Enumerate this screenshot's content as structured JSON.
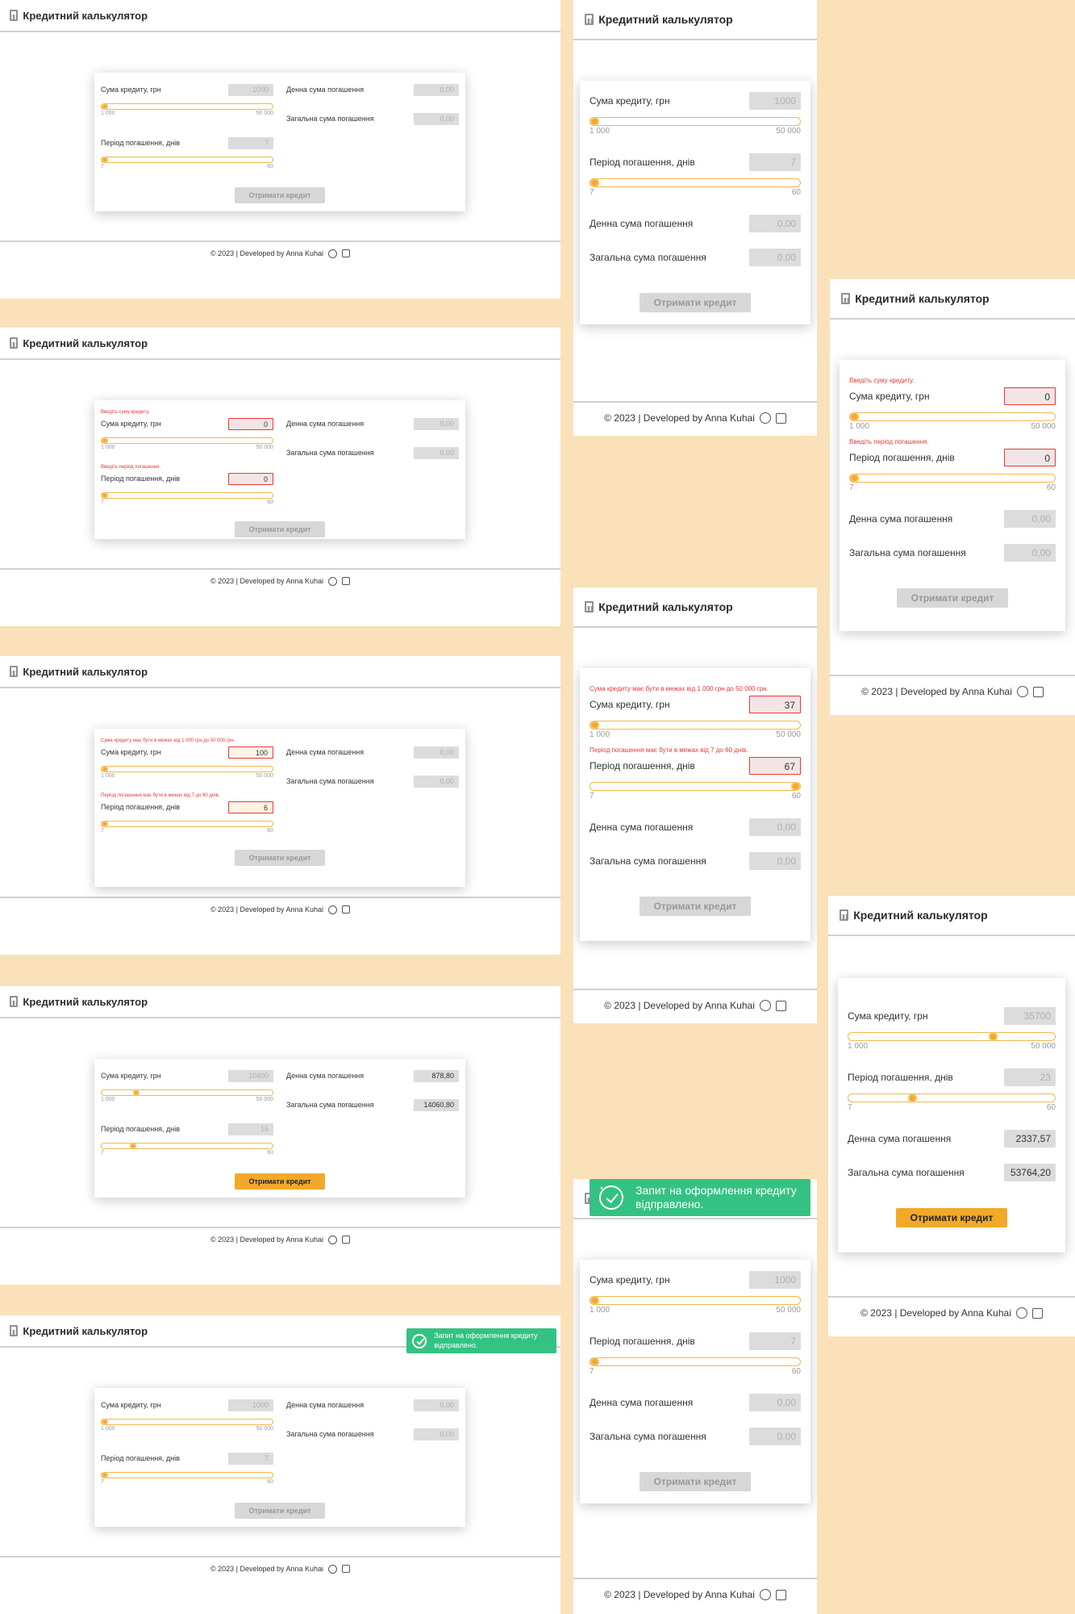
{
  "app": {
    "title": "Кредитний калькулятор",
    "footer": "© 2023 | Developed by Anna Kuhai",
    "amount_label": "Сума кредиту, грн",
    "period_label": "Період погашення, днів",
    "daily_label": "Денна сума погашення",
    "total_label": "Загальна сума погашення",
    "amount_min_tick": "1 000",
    "amount_max_tick": "50 000",
    "period_min_tick": "7",
    "period_max_tick": "60",
    "submit_label": "Отримати кредит",
    "err_amount_empty": "Введіть суму кредиту.",
    "err_period_empty": "Введіть період погашення.",
    "err_amount_range": "Сума кредиту має бути в межах від 1 000 грн до 50 000 грн.",
    "err_period_range": "Період погашення має бути в межах від 7 до 60 днів.",
    "toast_text": "Запит на оформлення кредиту відправлено."
  },
  "states": {
    "initial": {
      "amount": "1000",
      "period": "7",
      "daily": "0,00",
      "total": "0,00",
      "amount_pos": 0,
      "period_pos": 0
    },
    "empty": {
      "amount": "0",
      "period": "0",
      "daily": "0,00",
      "total": "0,00",
      "amount_pos": 0,
      "period_pos": 0
    },
    "out_of_range": {
      "amount": "100",
      "period": "6",
      "daily": "0,00",
      "total": "0,00",
      "amount_pos": 0,
      "period_pos": 0
    },
    "out_of_range_mobile": {
      "amount": "37",
      "period": "67",
      "daily": "0,00",
      "total": "0,00",
      "amount_pos": 0,
      "period_pos": 1
    },
    "valid_desktop": {
      "amount": "10400",
      "period": "16",
      "daily": "878,80",
      "total": "14060,80",
      "amount_pos": 0.19,
      "period_pos": 0.17
    },
    "valid_tablet": {
      "amount": "35700",
      "period": "23",
      "daily": "2337,57",
      "total": "53764,20",
      "amount_pos": 0.71,
      "period_pos": 0.3
    }
  },
  "colors": {
    "page_bg": "#fae1b9",
    "accent": "#f2a92a",
    "error": "#e53935",
    "toast": "#34c283",
    "disabled_btn": "#d7d7d7"
  },
  "icons": {
    "header": "calculator-icon",
    "footer_links": [
      "github-icon",
      "linkedin-icon"
    ],
    "toast": "check-circle-icon"
  }
}
